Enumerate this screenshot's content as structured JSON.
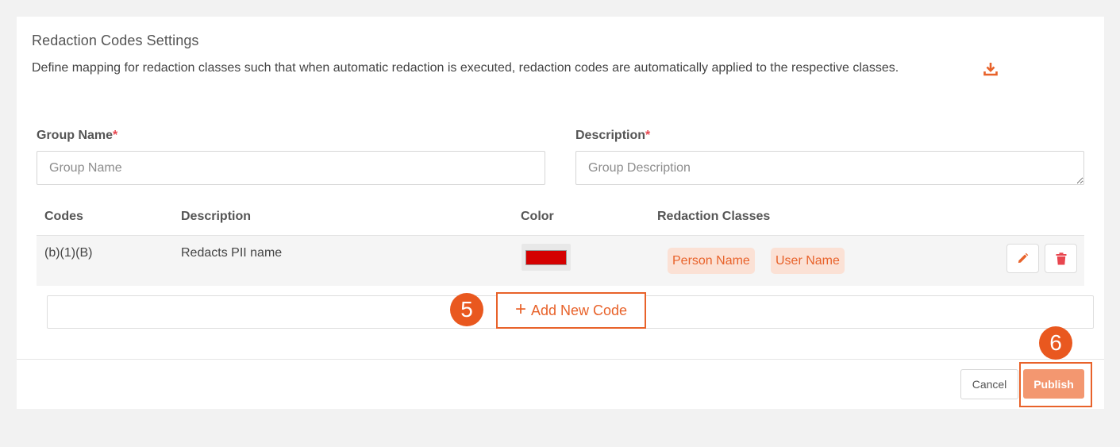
{
  "page": {
    "title": "Redaction Codes Settings",
    "description": "Define mapping for redaction classes such that when automatic redaction is executed, redaction codes are automatically applied to the respective classes."
  },
  "form": {
    "group_name": {
      "label": "Group Name",
      "required_mark": "*",
      "value": "",
      "placeholder": "Group Name"
    },
    "description": {
      "label": "Description",
      "required_mark": "*",
      "value": "",
      "placeholder": "Group Description"
    }
  },
  "table": {
    "headers": [
      "Codes",
      "Description",
      "Color",
      "Redaction Classes"
    ],
    "rows": [
      {
        "code": "(b)(1)(B)",
        "description": "Redacts PII name",
        "color": "#d40000",
        "classes": [
          "Person Name",
          "User Name"
        ]
      }
    ]
  },
  "actions": {
    "add_new_code": "Add New Code",
    "cancel": "Cancel",
    "publish": "Publish"
  },
  "annotations": {
    "step_add": "5",
    "step_publish": "6"
  },
  "colors": {
    "accent": "#e8622a",
    "badge": "#e9581f",
    "chip_bg": "#fbe1d5",
    "publish_bg": "#f39770"
  },
  "icons": {
    "download": "download-icon",
    "edit": "pencil-icon",
    "delete": "trash-icon",
    "add": "plus-icon"
  }
}
